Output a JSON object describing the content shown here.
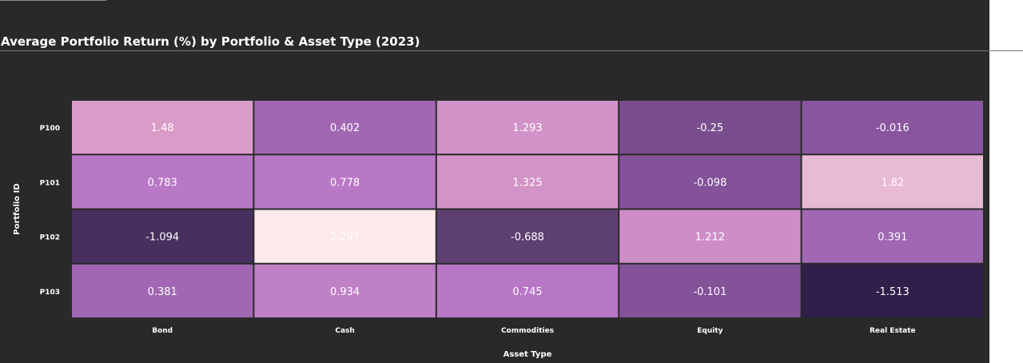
{
  "chart_data": {
    "type": "heatmap",
    "title": "Average Portfolio Return (%) by Portfolio & Asset Type (2023)",
    "xlabel": "Asset Type",
    "ylabel": "Portfolio ID",
    "x_categories": [
      "Bond",
      "Cash",
      "Commodities",
      "Equity",
      "Real Estate"
    ],
    "y_categories": [
      "P100",
      "P101",
      "P102",
      "P103"
    ],
    "values": [
      [
        1.48,
        0.402,
        1.293,
        -0.25,
        -0.016
      ],
      [
        0.783,
        0.778,
        1.325,
        -0.098,
        1.82
      ],
      [
        -1.094,
        2.297,
        -0.688,
        1.212,
        0.391
      ],
      [
        0.381,
        0.934,
        0.745,
        -0.101,
        -1.513
      ]
    ],
    "value_labels": [
      [
        "1.48",
        "0.402",
        "1.293",
        "-0.25",
        "-0.016"
      ],
      [
        "0.783",
        "0.778",
        "1.325",
        "-0.098",
        "1.82"
      ],
      [
        "-1.094",
        "2.297",
        "-0.688",
        "1.212",
        "0.391"
      ],
      [
        "0.381",
        "0.934",
        "0.745",
        "-0.101",
        "-1.513"
      ]
    ],
    "color_range": [
      -1.513,
      2.297
    ],
    "colorscale": [
      "#2f1f4a",
      "#5a3d6e",
      "#8a56a0",
      "#b978c6",
      "#dc9ec8",
      "#fde8ea"
    ],
    "grid": false,
    "legend": "none"
  }
}
